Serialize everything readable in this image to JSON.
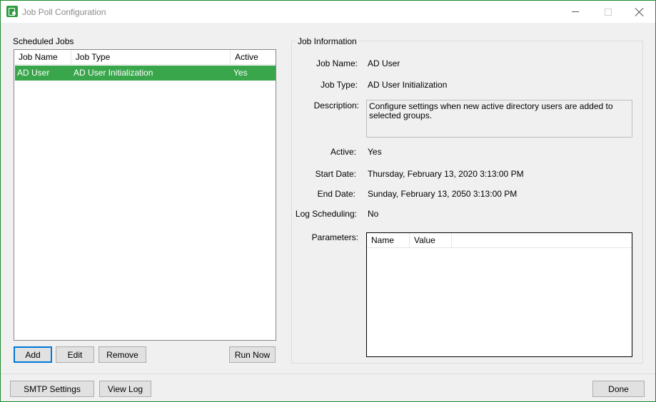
{
  "window": {
    "title": "Job Poll Configuration",
    "accent_color": "#2e9c3f",
    "selection_color": "#3aa64c"
  },
  "scheduled_jobs": {
    "label": "Scheduled Jobs",
    "columns": [
      "Job Name",
      "Job Type",
      "Active"
    ],
    "rows": [
      {
        "name": "AD User",
        "type": "AD User Initialization",
        "active": "Yes",
        "selected": true
      }
    ],
    "buttons": {
      "add": "Add",
      "edit": "Edit",
      "remove": "Remove",
      "run_now": "Run Now"
    }
  },
  "job_information": {
    "title": "Job Information",
    "job_name_label": "Job Name:",
    "job_name": "AD User",
    "job_type_label": "Job Type:",
    "job_type": "AD User Initialization",
    "description_label": "Description:",
    "description": "Configure settings when new active directory users are added to selected groups.",
    "active_label": "Active:",
    "active": "Yes",
    "start_date_label": "Start Date:",
    "start_date": "Thursday, February 13, 2020 3:13:00 PM",
    "end_date_label": "End Date:",
    "end_date": "Sunday, February 13, 2050 3:13:00 PM",
    "log_scheduling_label": "Log Scheduling:",
    "log_scheduling": "No",
    "parameters_label": "Parameters:",
    "parameter_columns": [
      "Name",
      "Value"
    ]
  },
  "footer": {
    "smtp_settings": "SMTP Settings",
    "view_log": "View Log",
    "done": "Done"
  }
}
